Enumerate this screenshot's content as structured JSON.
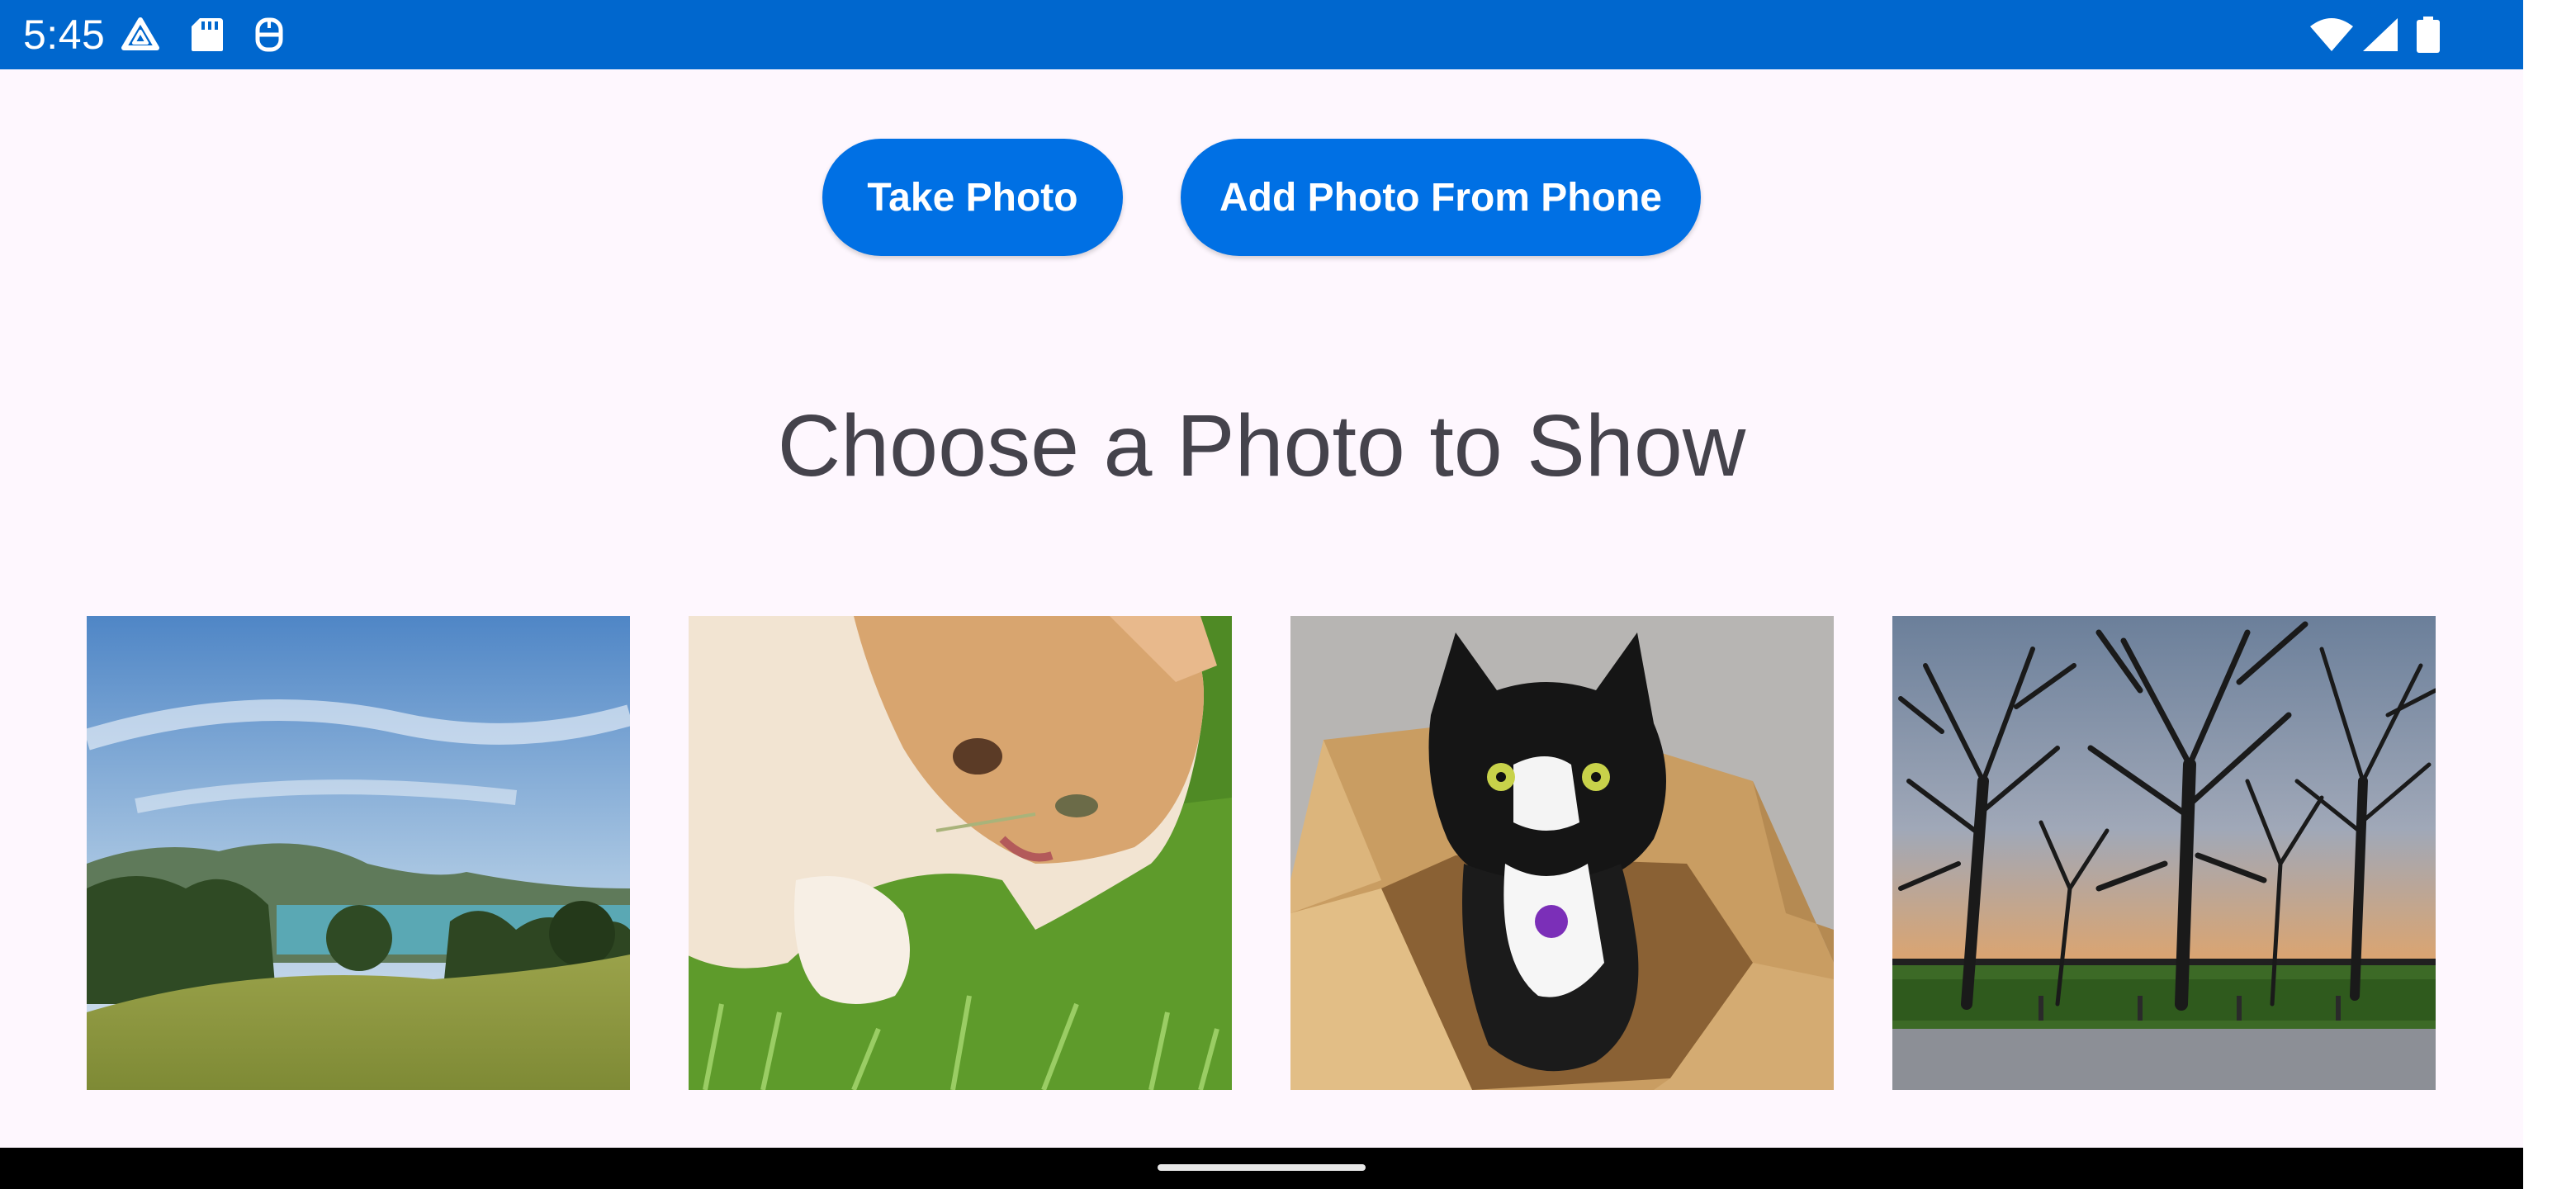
{
  "status_bar": {
    "time": "5:45",
    "left_icons": [
      "drive-icon",
      "sd-card-icon",
      "dev-tools-icon"
    ],
    "right_icons": [
      "wifi-icon",
      "cell-signal-icon",
      "battery-icon"
    ],
    "color": "#0067ce"
  },
  "actions": {
    "take_photo_label": "Take Photo",
    "add_photo_label": "Add Photo From Phone",
    "button_color": "#0070e4"
  },
  "heading": "Choose a Photo to Show",
  "photos": [
    {
      "subject": "landscape with hills, lake and trees under a blue sky"
    },
    {
      "subject": "ginger and white cat chewing grass"
    },
    {
      "subject": "black and white cat sitting in a cardboard box"
    },
    {
      "subject": "bare trees silhouetted against a sunset"
    }
  ],
  "colors": {
    "background": "#fef7fe",
    "heading_text": "#45434c",
    "nav_bar": "#000000"
  }
}
